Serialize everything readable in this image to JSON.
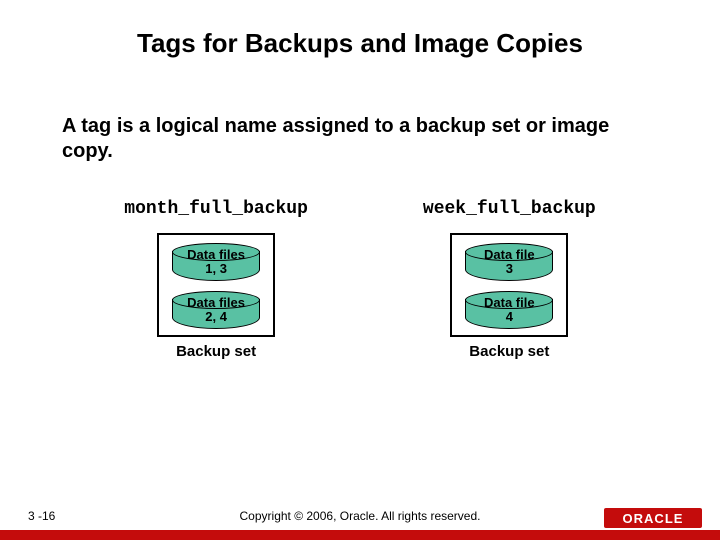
{
  "title": "Tags for Backups and Image Copies",
  "subtitle": "A tag is a logical name assigned to a backup set or image copy.",
  "left": {
    "tag": "month_full_backup",
    "disk1_line1": "Data files",
    "disk1_line2": "1, 3",
    "disk2_line1": "Data files",
    "disk2_line2": "2, 4",
    "caption": "Backup set"
  },
  "right": {
    "tag": "week_full_backup",
    "disk1_line1": "Data file",
    "disk1_line2": "3",
    "disk2_line1": "Data file",
    "disk2_line2": "4",
    "caption": "Backup set"
  },
  "footer": {
    "slide_num": "3 -16",
    "copyright": "Copyright © 2006, Oracle. All rights reserved.",
    "logo": "ORACLE"
  }
}
